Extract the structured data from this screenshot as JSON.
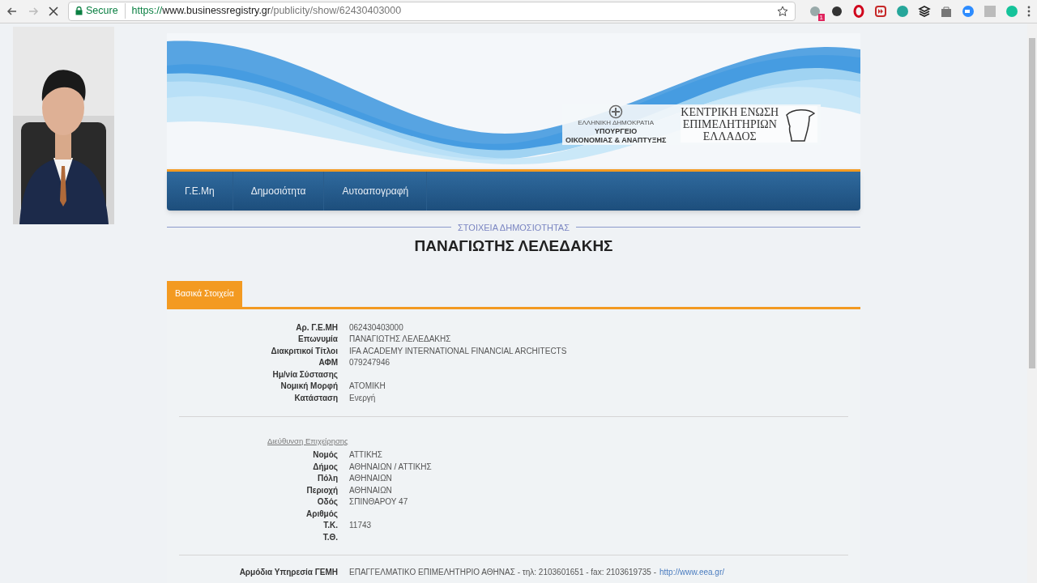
{
  "browser": {
    "security": "Secure",
    "url": {
      "scheme": "https://",
      "host": "www.businessregistry.gr",
      "path": "/publicity/show/62430403000"
    },
    "loading": true,
    "extension_badge": "1"
  },
  "banner": {
    "ministry": [
      "ΕΛΛΗΝΙΚΗ ΔΗΜΟΚΡΑΤΙΑ",
      "ΥΠΟΥΡΓΕΙΟ",
      "ΟΙΚΟΝΟΜΙΑΣ & ΑΝΑΠΤΥΞΗΣ"
    ],
    "chamber": [
      "ΚΕΝΤΡΙΚΗ ΕΝΩΣΗ",
      "ΕΠΙΜΕΛΗΤΗΡΙΩΝ",
      "ΕΛΛΑΔΟΣ"
    ]
  },
  "nav": [
    {
      "label": "Γ.Ε.Μη",
      "selected": false
    },
    {
      "label": "Δημοσιότητα",
      "selected": false
    },
    {
      "label": "Αυτοαπογραφή",
      "selected": false
    }
  ],
  "section_heading": "ΣΤΟΙΧΕΙΑ ΔΗΜΟΣΙΟΤΗΤΑΣ",
  "entity_name": "ΠΑΝΑΓΙΩΤΗΣ ΛΕΛΕΔΑΚΗΣ",
  "tabs": [
    {
      "label": "Βασικά Στοιχεία",
      "selected": true
    }
  ],
  "basic": [
    {
      "label": "Αρ. Γ.Ε.ΜΗ",
      "value": "062430403000"
    },
    {
      "label": "Επωνυμία",
      "value": "ΠΑΝΑΓΙΩΤΗΣ ΛΕΛΕΔΑΚΗΣ"
    },
    {
      "label": "Διακριτικοί Τίτλοι",
      "value": "IFA ACADEMY INTERNATIONAL FINANCIAL ARCHITECTS"
    },
    {
      "label": "ΑΦΜ",
      "value": "079247946"
    },
    {
      "label": "Ημ/νία Σύστασης"
    },
    {
      "label": "Νομική Μορφή",
      "value": "ΑΤΟΜΙΚΗ"
    },
    {
      "label": "Κατάσταση",
      "value": "Ενεργή"
    }
  ],
  "address_heading": "Διεύθυνση Επιχείρησης",
  "address": [
    {
      "label": "Νομός",
      "value": "ΑΤΤΙΚΗΣ"
    },
    {
      "label": "Δήμος",
      "value": "ΑΘΗΝΑΙΩΝ / ΑΤΤΙΚΗΣ"
    },
    {
      "label": "Πόλη",
      "value": "ΑΘΗΝΑΙΩΝ"
    },
    {
      "label": "Περιοχή",
      "value": "ΑΘΗΝΑΙΩΝ"
    },
    {
      "label": "Οδός",
      "value": "ΣΠΙΝΘΑΡΟΥ 47"
    },
    {
      "label": "Αριθμός"
    },
    {
      "label": "Τ.Κ.",
      "value": "11743"
    },
    {
      "label": "Τ.Θ."
    }
  ],
  "authority": {
    "label": "Αρμόδια Υπηρεσία ΓΕΜΗ",
    "text": "ΕΠΑΓΓΕΛΜΑΤΙΚΟ ΕΠΙΜΕΛΗΤΗΡΙΟ ΑΘΗΝΑΣ - τηλ: 2103601651 - fax: 2103619735 -",
    "link": "http://www.eea.gr/"
  }
}
